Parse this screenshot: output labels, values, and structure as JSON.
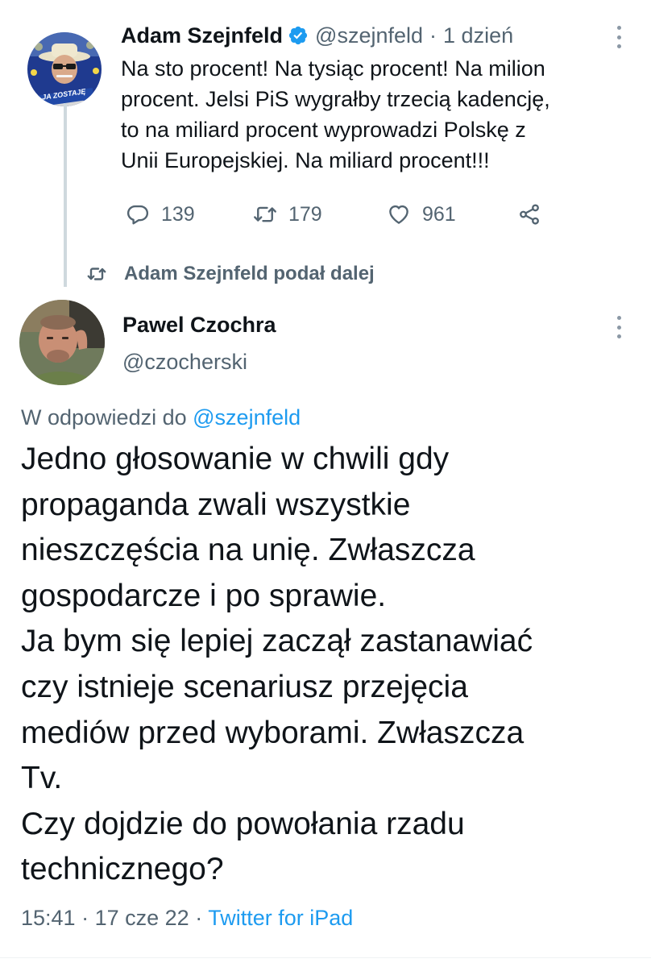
{
  "colors": {
    "text": "#0f1419",
    "muted": "#536471",
    "link": "#1d9bf0",
    "verified": "#1d9bf0",
    "thread_line": "#cfd9de"
  },
  "tweet1": {
    "avatar_icon": "avatar-adam-szejnfeld",
    "avatar_badge_text": "JA ZOSTAJĘ",
    "name": "Adam Szejnfeld",
    "verified_icon": "verified-badge-icon",
    "handle": "@szejnfeld",
    "separator": "·",
    "time": "1 dzień",
    "text": "Na sto procent! Na tysiąc procent! Na milion\nprocent. Jelsi PiS wygrałby trzecią  kadencję,\nto na miliard procent wyprowadzi Polskę z\nUnii Europejskiej. Na miliard procent!!!",
    "replies": "139",
    "retweets": "179",
    "likes": "961"
  },
  "retweet_context": {
    "icon": "retweet-icon",
    "label": "Adam Szejnfeld podał dalej"
  },
  "tweet2": {
    "avatar_icon": "avatar-pawel-czochra",
    "name": "Pawel Czochra",
    "handle": "@czocherski",
    "reply_prefix": "W odpowiedzi do",
    "reply_to": "@szejnfeld",
    "text": "Jedno głosowanie w chwili gdy\npropaganda zwali wszystkie\nnieszczęścia na unię. Zwłaszcza\ngospodarcze i po sprawie.\nJa bym się lepiej zaczął zastanawiać\nczy istnieje scenariusz przejęcia\nmediów przed wyborami. Zwłaszcza\nTv.\nCzy dojdzie do powołania rzadu\ntechnicznego?",
    "time": "15:41",
    "separator1": "·",
    "date": "17 cze 22",
    "separator2": "·",
    "source": "Twitter for iPad"
  }
}
